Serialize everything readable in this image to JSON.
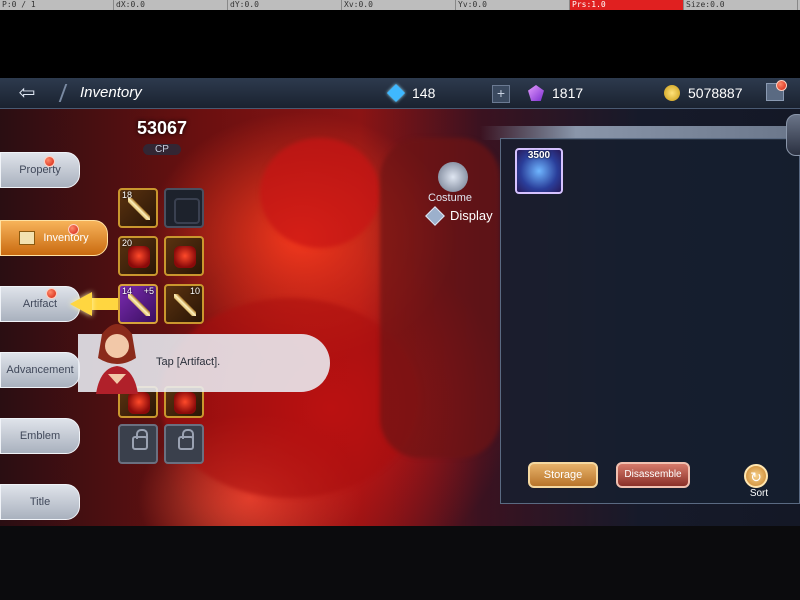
{
  "debug": {
    "cells": [
      "P:0 / 1",
      "dX:0.0",
      "dY:0.0",
      "Xv:0.0",
      "Yv:0.0",
      "Prs:1.0",
      "Size:0.0"
    ]
  },
  "header": {
    "title": "Inventory",
    "back_icon": "back-arrow-icon",
    "currencies": [
      {
        "name": "diamond",
        "icon": "diamond-icon",
        "value": "148",
        "color": "#3fb8ff"
      },
      {
        "name": "gem",
        "icon": "purple-gem-icon",
        "value": "1817",
        "color": "#b04ae8"
      },
      {
        "name": "gold",
        "icon": "gold-coin-icon",
        "value": "5078887",
        "color": "#e0b030"
      }
    ]
  },
  "sidebar": {
    "tabs": [
      {
        "label": "Property",
        "badge": true
      },
      {
        "label": "Inventory",
        "badge": true,
        "active": true
      },
      {
        "label": "Artifact",
        "badge": true
      },
      {
        "label": "Advancement",
        "badge": false
      },
      {
        "label": "Emblem",
        "badge": false
      },
      {
        "label": "Title",
        "badge": false
      }
    ]
  },
  "character": {
    "cp_value": "53067",
    "cp_label": "CP",
    "slots": [
      {
        "type": "sword",
        "level": "18",
        "filled": true
      },
      {
        "type": "empty",
        "filled": false
      },
      {
        "type": "armor",
        "level": "20",
        "filled": true
      },
      {
        "type": "armor",
        "filled": true
      },
      {
        "type": "purple-sword",
        "level": "14",
        "level_right": "+5",
        "filled": true
      },
      {
        "type": "spear",
        "level_right": "10",
        "filled": true
      },
      {
        "type": "locked"
      },
      {
        "type": "locked"
      }
    ]
  },
  "tutorial": {
    "text": "Tap [Artifact]."
  },
  "costume": {
    "costume_label": "Costume",
    "display_label": "Display"
  },
  "right_panel": {
    "card_value": "3500",
    "storage_label": "Storage",
    "disassemble_label": "Disassemble",
    "sort_label": "Sort"
  },
  "colors": {
    "accent": "#f7b35a",
    "badge": "#d22010",
    "panel": "#162030"
  }
}
